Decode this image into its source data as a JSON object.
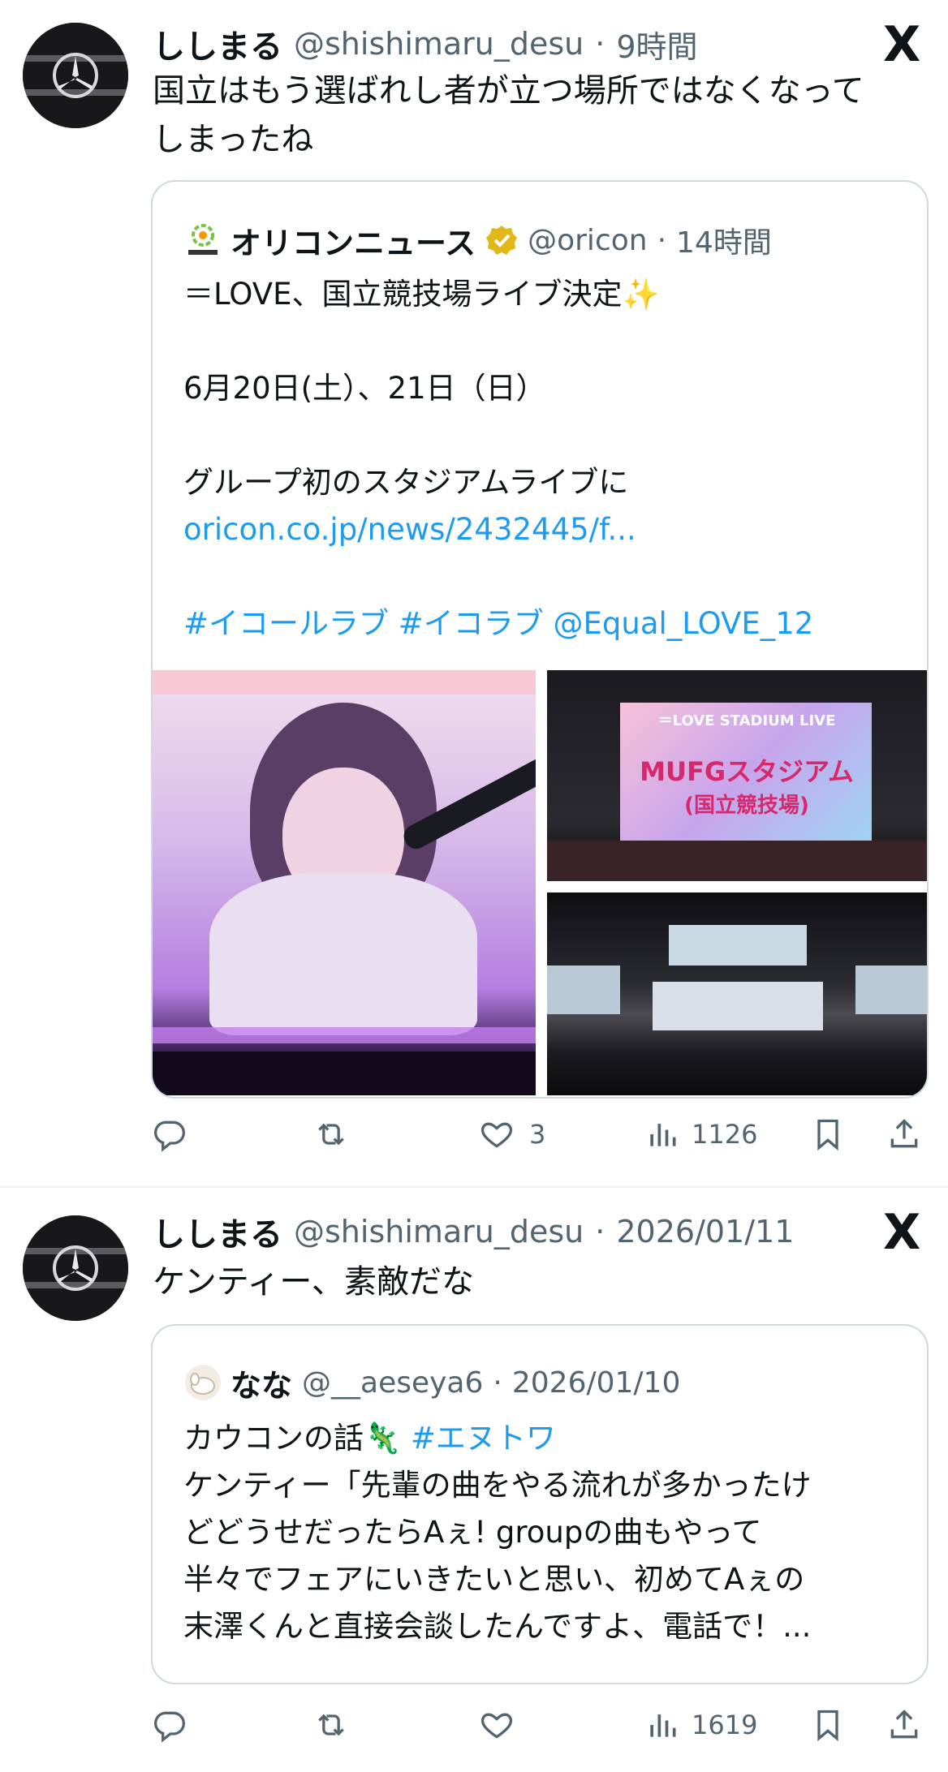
{
  "posts": [
    {
      "name": "ししまる",
      "handle": "@shishimaru_desu",
      "sep": "·",
      "time": "9時間",
      "text_line1": "国立はもう選ばれし者が立つ場所ではなくなって",
      "text_line2": "しまったね",
      "quote": {
        "name": "オリコンニュース",
        "handle": "@oricon",
        "sep": "·",
        "time": "14時間",
        "line1": "＝LOVE、国立競技場ライブ決定✨",
        "line2": "6月20日(土）、21日（日）",
        "line3": "グループ初のスタジアムライブに",
        "link": "oricon.co.jp/news/2432445/f...",
        "tags": "#イコールラブ #イコラブ @Equal_LOVE_12",
        "screen_line1": "＝LOVE STADIUM LIVE",
        "screen_line2": "MUFGスタジアム",
        "screen_line3": "(国立競技場)"
      },
      "actions": {
        "reply": "",
        "repost": "",
        "like": "3",
        "views": "1126"
      }
    },
    {
      "name": "ししまる",
      "handle": "@shishimaru_desu",
      "sep": "·",
      "time": "2026/01/11",
      "text_line1": "ケンティー、素敵だな",
      "quote": {
        "name": "なな",
        "handle": "@__aeseya6",
        "sep": "·",
        "time": "2026/01/10",
        "line1": "カウコンの話🦎",
        "line1_tag": "#エヌトワ",
        "line2": "ケンティー「先輩の曲をやる流れが多かったけ",
        "line3": "どどうせだったらAぇ! groupの曲もやって",
        "line4": "半々でフェアにいきたいと思い、初めてAぇの",
        "line5": "末澤くんと直接会談したんですよ、電話で！..."
      },
      "actions": {
        "reply": "",
        "repost": "",
        "like": "",
        "views": "1619"
      }
    }
  ],
  "icons": {
    "x_logo": "X",
    "reply": "reply-icon",
    "repost": "repost-icon",
    "like": "heart-icon",
    "views": "views-icon",
    "bookmark": "bookmark-icon",
    "share": "share-icon"
  },
  "colors": {
    "link": "#1d9bf0",
    "muted": "#536471",
    "verified": "#e2b719"
  }
}
